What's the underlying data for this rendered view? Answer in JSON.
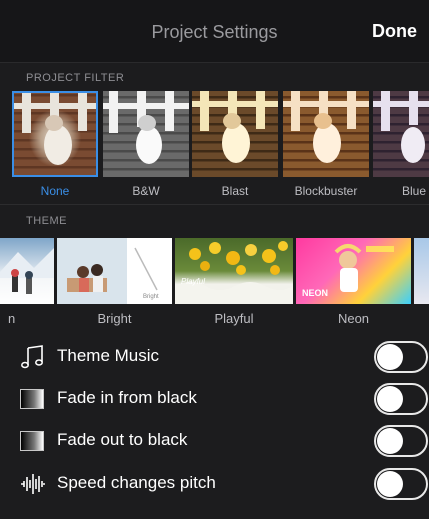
{
  "header": {
    "title": "Project Settings",
    "done_label": "Done"
  },
  "filters": {
    "section_label": "PROJECT FILTER",
    "items": [
      {
        "label": "None",
        "selected": true
      },
      {
        "label": "B&W",
        "selected": false
      },
      {
        "label": "Blast",
        "selected": false
      },
      {
        "label": "Blockbuster",
        "selected": false
      },
      {
        "label": "Blue",
        "selected": false
      }
    ]
  },
  "themes": {
    "section_label": "THEME",
    "items": [
      {
        "label": "n"
      },
      {
        "label": "Bright",
        "overlay": "Bright"
      },
      {
        "label": "Playful",
        "overlay": "Playful"
      },
      {
        "label": "Neon",
        "overlay": "NEON"
      }
    ]
  },
  "settings": [
    {
      "label": "Theme Music",
      "icon": "music-note-icon",
      "on": false
    },
    {
      "label": "Fade in from black",
      "icon": "fade-in-icon",
      "on": false
    },
    {
      "label": "Fade out to black",
      "icon": "fade-out-icon",
      "on": false
    },
    {
      "label": "Speed changes pitch",
      "icon": "waveform-icon",
      "on": false
    }
  ],
  "colors": {
    "accent": "#3a8ee6",
    "background": "#1c1c1e"
  }
}
